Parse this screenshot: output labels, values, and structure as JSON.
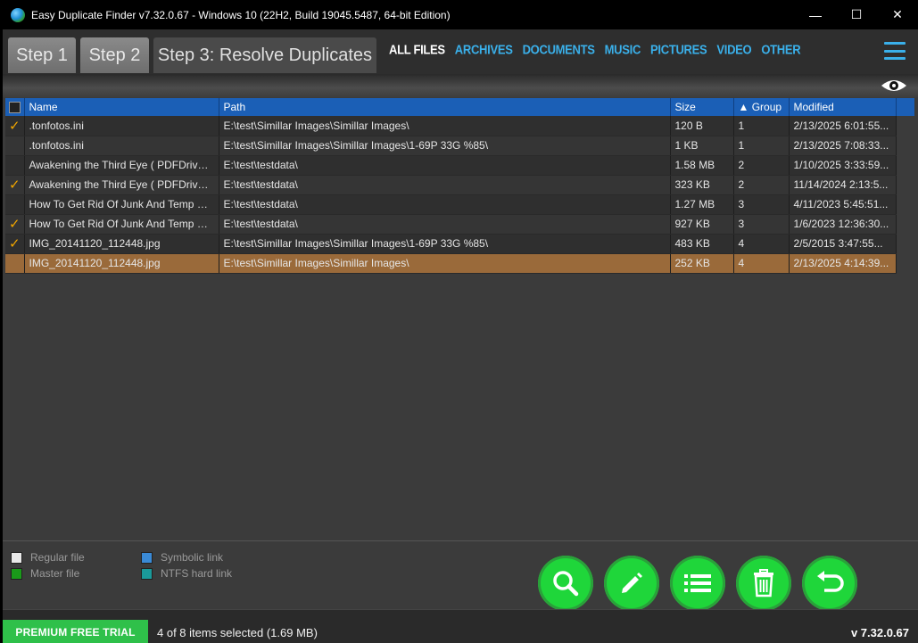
{
  "window": {
    "title": "Easy Duplicate Finder v7.32.0.67 - Windows 10 (22H2, Build 19045.5487, 64-bit Edition)",
    "minimize": "—",
    "maximize": "☐",
    "close": "✕"
  },
  "tabs": {
    "step1": "Step 1",
    "step2": "Step 2",
    "step3": "Step 3: Resolve Duplicates"
  },
  "filters": [
    "ALL FILES",
    "ARCHIVES",
    "DOCUMENTS",
    "MUSIC",
    "PICTURES",
    "VIDEO",
    "OTHER"
  ],
  "table": {
    "headers": {
      "name": "Name",
      "path": "Path",
      "size": "Size",
      "group": "▲ Group",
      "modified": "Modified"
    },
    "rows": [
      {
        "checked": "✓",
        "name": ".tonfotos.ini",
        "path": "E:\\test\\Simillar Images\\Simillar Images\\",
        "size": "120 B",
        "group": "1",
        "modified": "2/13/2025 6:01:55..."
      },
      {
        "checked": "",
        "name": ".tonfotos.ini",
        "path": "E:\\test\\Simillar Images\\Simillar Images\\1-69P 33G %85\\",
        "size": "1 KB",
        "group": "1",
        "modified": "2/13/2025 7:08:33..."
      },
      {
        "checked": "",
        "name": "Awakening the Third Eye ( PDFDrive )...",
        "path": "E:\\test\\testdata\\",
        "size": "1.58 MB",
        "group": "2",
        "modified": "1/10/2025 3:33:59..."
      },
      {
        "checked": "✓",
        "name": "Awakening the Third Eye ( PDFDrive )...",
        "path": "E:\\test\\testdata\\",
        "size": "323 KB",
        "group": "2",
        "modified": "11/14/2024 2:13:5..."
      },
      {
        "checked": "",
        "name": "How To Get Rid Of Junk And Temp Fil...",
        "path": "E:\\test\\testdata\\",
        "size": "1.27 MB",
        "group": "3",
        "modified": "4/11/2023 5:45:51..."
      },
      {
        "checked": "✓",
        "name": "How To Get Rid Of Junk And Temp Fil...",
        "path": "E:\\test\\testdata\\",
        "size": "927 KB",
        "group": "3",
        "modified": "1/6/2023 12:36:30..."
      },
      {
        "checked": "✓",
        "name": "IMG_20141120_112448.jpg",
        "path": "E:\\test\\Simillar Images\\Simillar Images\\1-69P 33G %85\\",
        "size": "483 KB",
        "group": "4",
        "modified": "2/5/2015 3:47:55..."
      },
      {
        "checked": "",
        "name": "IMG_20141120_112448.jpg",
        "path": "E:\\test\\Simillar Images\\Simillar Images\\",
        "size": "252 KB",
        "group": "4",
        "modified": "2/13/2025 4:14:39..."
      }
    ]
  },
  "legend": {
    "regular": "Regular file",
    "master": "Master file",
    "symlink": "Symbolic link",
    "hardlink": "NTFS hard link"
  },
  "colors": {
    "regular": "#e8e8e8",
    "master": "#1a9a1a",
    "symlink": "#3a8ad6",
    "hardlink": "#1a9a9a",
    "accent": "#3ab0ea",
    "action": "#1fd63a"
  },
  "actions": [
    "search-icon",
    "edit-icon",
    "list-icon",
    "trash-icon",
    "undo-icon"
  ],
  "status": {
    "premium": "PREMIUM FREE TRIAL",
    "selection": "4 of 8 items selected (1.69 MB)",
    "version": "v 7.32.0.67"
  }
}
